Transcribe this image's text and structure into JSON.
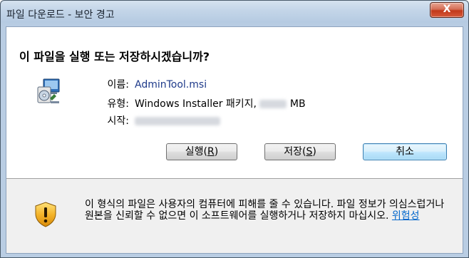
{
  "window": {
    "title": "파일 다운로드 - 보안 경고",
    "close_label": "X"
  },
  "dialog": {
    "question": "이 파일을 실행 또는 저장하시겠습니까?",
    "fields": [
      {
        "label": "이름:",
        "value": "AdminTool.msi"
      },
      {
        "label": "유형:",
        "value_prefix": "Windows Installer 패키지,",
        "value_suffix": "MB"
      },
      {
        "label": "시작:"
      }
    ]
  },
  "buttons": {
    "run_text": "실행(",
    "run_mnemonic": "R",
    "run_close": ")",
    "save_text": "저장(",
    "save_mnemonic": "S",
    "save_close": ")",
    "cancel": "취소"
  },
  "footer": {
    "warning": "이 형식의 파일은 사용자의 컴퓨터에 피해를 줄 수 있습니다. 파일 정보가 의심스럽거나 원본을 신뢰할 수 없으면 이 소프트웨어를 실행하거나 저장하지 마십시오.",
    "link": "위험성"
  },
  "icons": {
    "file": "msi-installer-icon",
    "warning": "security-shield-icon",
    "close": "close-icon"
  },
  "colors": {
    "close_button": "#c2381a",
    "link": "#0066cc",
    "default_button_border": "#3c7fb1"
  }
}
